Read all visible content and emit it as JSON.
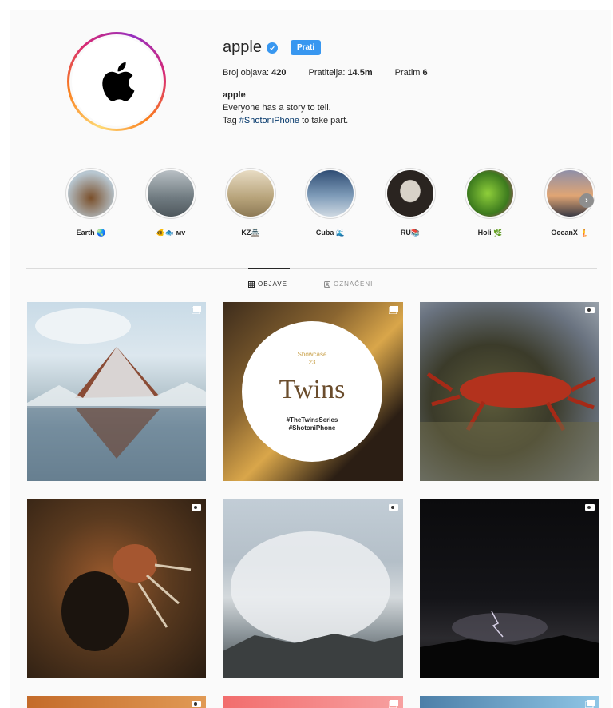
{
  "profile": {
    "username": "apple",
    "follow_label": "Prati",
    "stats": {
      "posts_label": "Broj objava:",
      "posts_value": "420",
      "followers_label": "Pratitelja:",
      "followers_value": "14.5m",
      "following_label": "Pratim",
      "following_value": "6"
    },
    "bio": {
      "name": "apple",
      "line1": "Everyone has a story to tell.",
      "line2_prefix": "Tag ",
      "hashtag": "#ShotoniPhone",
      "line2_suffix": " to take part."
    }
  },
  "highlights": [
    {
      "label": "Earth 🌏",
      "color": "#8a7a62"
    },
    {
      "label": "🐠🐟 мv",
      "color": "#8c969c"
    },
    {
      "label": "KZ🏯",
      "color": "#c3b48f"
    },
    {
      "label": "Cuba 🌊",
      "color": "#4b6a8f"
    },
    {
      "label": "RU📚",
      "color": "#2a2420"
    },
    {
      "label": "Holi 🌿",
      "color": "#4e8a2b"
    },
    {
      "label": "OceanX 🧜",
      "color": "#b8876a"
    }
  ],
  "highlights_next_icon": "chevron-right-icon",
  "tabs": [
    {
      "label": "OBJAVE",
      "icon": "grid-icon",
      "active": true
    },
    {
      "label": "OZNAČENI",
      "icon": "tagged-icon",
      "active": false
    }
  ],
  "posts": [
    {
      "type": "carousel",
      "badge_icon": "carousel-icon"
    },
    {
      "type": "carousel",
      "badge_icon": "carousel-icon",
      "overlay": {
        "show": "Showcase",
        "number": "23",
        "title": "Twins",
        "tag1": "#TheTwinsSeries",
        "tag2": "#ShotoniPhone"
      }
    },
    {
      "type": "video",
      "badge_icon": "video-icon"
    },
    {
      "type": "video",
      "badge_icon": "video-icon"
    },
    {
      "type": "video",
      "badge_icon": "video-icon"
    },
    {
      "type": "video",
      "badge_icon": "video-icon"
    },
    {
      "type": "video",
      "badge_icon": "video-icon"
    },
    {
      "type": "carousel",
      "badge_icon": "carousel-icon"
    },
    {
      "type": "carousel",
      "badge_icon": "carousel-icon"
    }
  ],
  "colors": {
    "accent": "#3897f0",
    "text": "#262626",
    "muted": "#8e8e8e",
    "border": "#dbdbdb",
    "background": "#fafafa",
    "hashtag": "#003569"
  }
}
